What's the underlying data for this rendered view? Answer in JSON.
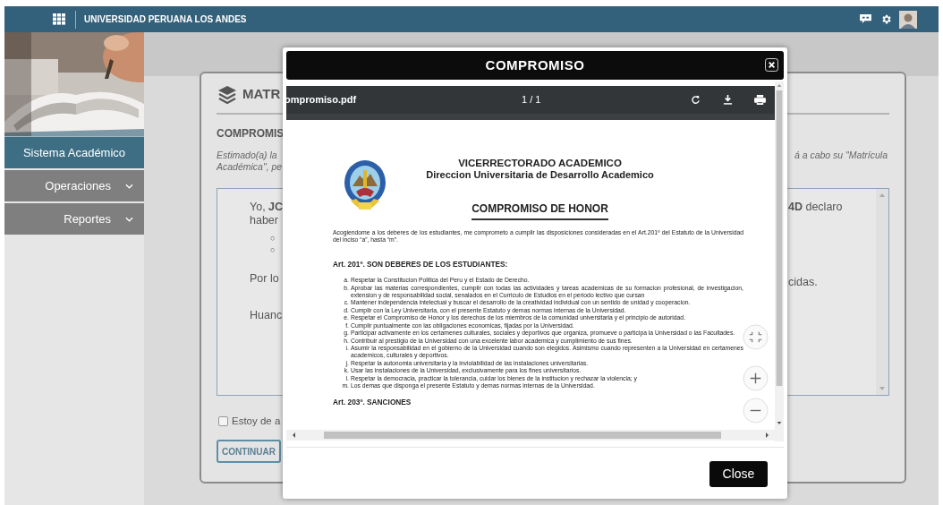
{
  "topbar": {
    "title": "UNIVERSIDAD PERUANA LOS ANDES"
  },
  "sidebar": {
    "items": [
      {
        "label": "Sistema Académico",
        "kind": "header"
      },
      {
        "label": "Operaciones",
        "kind": "menu"
      },
      {
        "label": "Reportes",
        "kind": "menu"
      }
    ]
  },
  "card": {
    "title": "MATR",
    "section": "COMPROMIS",
    "intro_left": [
      "Estimado(a) la",
      "Académica\", pe"
    ],
    "intro_right": "á a cabo su \"Matrícula",
    "box_left": {
      "line1": "Yo, **JC**",
      "line2": "haber",
      "bullets": [
        "○",
        "○"
      ],
      "para2": "Por lo",
      "para3": "Huanc"
    },
    "box_right": {
      "line1": "**4D** declaro",
      "para2": "cidas."
    },
    "agreement": {
      "label": "Estoy de a",
      "checked": false
    },
    "continue_button": "CONTINUAR"
  },
  "modal": {
    "title": "COMPROMISO",
    "pdf": {
      "filename": "ompromiso.pdf",
      "page": "1 / 1",
      "document": {
        "header": [
          "VICERRECTORADO ACADEMICO",
          "Direccion Universitaria de Desarrollo Academico"
        ],
        "title": "COMPROMISO DE HONOR",
        "intro": "Acogiendome a los deberes de los estudiantes, me comprometo a cumplir las disposiciones consideradas en el Art.201º del Estatuto de la Universidad del inciso “a”, hasta “m”.",
        "article_1": "Art. 201º. SON DEBERES DE LOS ESTUDIANTES:",
        "items": [
          {
            "marker": "a.",
            "text": "Respetar la Constitucion Politica del Peru y el Estado de Derecho."
          },
          {
            "marker": "b.",
            "text": "Aprobar las materias correspondientes, cumplir con todas las actividades y tareas academicas de su formacion profesional, de investigacion, extension y de responsabilidad social, senalados en el Curriculo de Estudios en el periodo lectivo que cursan"
          },
          {
            "marker": "c.",
            "text": "Mantener independencia intelectual y buscar el desarrollo de la creatividad individual con un sentido de unidad y cooperacion."
          },
          {
            "marker": "d.",
            "text": "Cumplir con la Ley Universitaria, con el presente Estatuto y demas normas internas de la Universidad."
          },
          {
            "marker": "e.",
            "text": "Respetar el Compromiso de Honor y los derechos de los miembros de la comunidad universitaria y el principio de autoridad."
          },
          {
            "marker": "f.",
            "text": "Cumplir puntualmente con las obligaciones economicas, fijadas por la Universidad."
          },
          {
            "marker": "g.",
            "text": "Participar activamente en los certamenes culturales, sociales y deportivos que organiza, promueve o participa la Universidad o las Facultades."
          },
          {
            "marker": "h.",
            "text": "Contribuir al prestigio de la Universidad con una excelente labor academica y cumplimiento de sus fines."
          },
          {
            "marker": "i.",
            "text": "Asumir la responsabilidad en el gobierno de la Universidad cuando son elegidos. Asimismo cuando representen a la Universidad en certamenes academicos, culturales y deportivos."
          },
          {
            "marker": "j.",
            "text": "Respetar la autonomia universitaria y la inviolabilidad de las instalaciones universitarias."
          },
          {
            "marker": "k.",
            "text": "Usar las instalaciones de la Universidad, exclusivamente para los fines universitarios."
          },
          {
            "marker": "l.",
            "text": "Respetar la democracia, practicar la tolerancia, cuidar los bienes de la institucion y rechazar la violencia; y"
          },
          {
            "marker": "m.",
            "text": "Los demas que disponga el presente Estatuto y demas normas internas de la Universidad."
          }
        ],
        "article_2": "Art. 203º. SANCIONES"
      }
    },
    "close_button": "Close"
  }
}
